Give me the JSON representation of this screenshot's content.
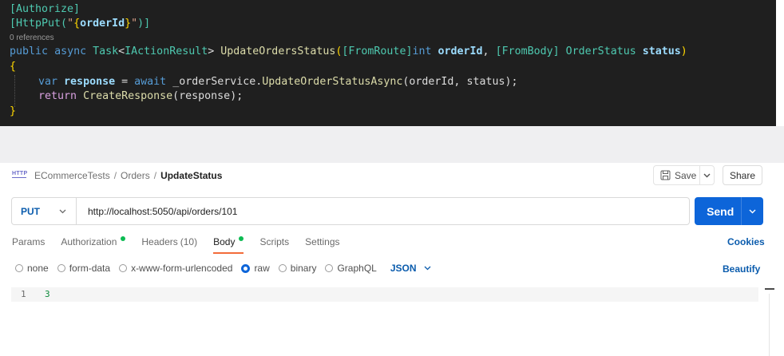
{
  "code": {
    "attr1": "[Authorize]",
    "attr2_open": "[HttpPut(",
    "attr2_str_open": "\"",
    "attr2_brace_open": "{",
    "attr2_param": "orderId",
    "attr2_brace_close": "}",
    "attr2_str_close": "\"",
    "attr2_close": ")]",
    "references": "0 references",
    "sig_public": "public",
    "sig_async": "async",
    "sig_task": "Task",
    "sig_lt": "<",
    "sig_iaction": "IActionResult",
    "sig_gt": ">",
    "sig_name": "UpdateOrdersStatus",
    "sig_paren_open": "(",
    "sig_fromroute": "[FromRoute]",
    "sig_int": "int",
    "sig_orderid": "orderId",
    "sig_comma": ",",
    "sig_frombody": "[FromBody]",
    "sig_orderstatus": "OrderStatus",
    "sig_status": "status",
    "sig_paren_close": ")",
    "brace_open": "{",
    "l1_var": "var",
    "l1_response": "response",
    "l1_eq": "=",
    "l1_await": "await",
    "l1_svc": "_orderService.",
    "l1_method": "UpdateOrderStatusAsync",
    "l1_args": "(orderId, status);",
    "l2_return": "return",
    "l2_method": "CreateResponse",
    "l2_args": "(response);",
    "brace_close": "}"
  },
  "breadcrumb": {
    "icon_text": "HTTP",
    "collection": "ECommerceTests",
    "separator": "/",
    "folder": "Orders",
    "request": "UpdateStatus"
  },
  "actions": {
    "save_label": "Save",
    "share_label": "Share"
  },
  "request": {
    "method": "PUT",
    "url": "http://localhost:5050/api/orders/101",
    "send_label": "Send"
  },
  "tabs": [
    {
      "label": "Params"
    },
    {
      "label": "Authorization",
      "indicator": true
    },
    {
      "label": "Headers",
      "count": "(10)"
    },
    {
      "label": "Body",
      "indicator": true,
      "active": true
    },
    {
      "label": "Scripts"
    },
    {
      "label": "Settings"
    }
  ],
  "cookies_label": "Cookies",
  "body_types": [
    {
      "label": "none",
      "selected": false
    },
    {
      "label": "form-data",
      "selected": false
    },
    {
      "label": "x-www-form-urlencoded",
      "selected": false
    },
    {
      "label": "raw",
      "selected": true
    },
    {
      "label": "binary",
      "selected": false
    },
    {
      "label": "GraphQL",
      "selected": false
    }
  ],
  "body_language": "JSON",
  "beautify_label": "Beautify",
  "editor": {
    "line_number": "1",
    "content": "3"
  },
  "colors": {
    "accent": "#0d65d9",
    "active_tab_underline": "#f26b3a",
    "indicator_dot": "#0cbb52",
    "code_background": "#1f1f1f"
  }
}
